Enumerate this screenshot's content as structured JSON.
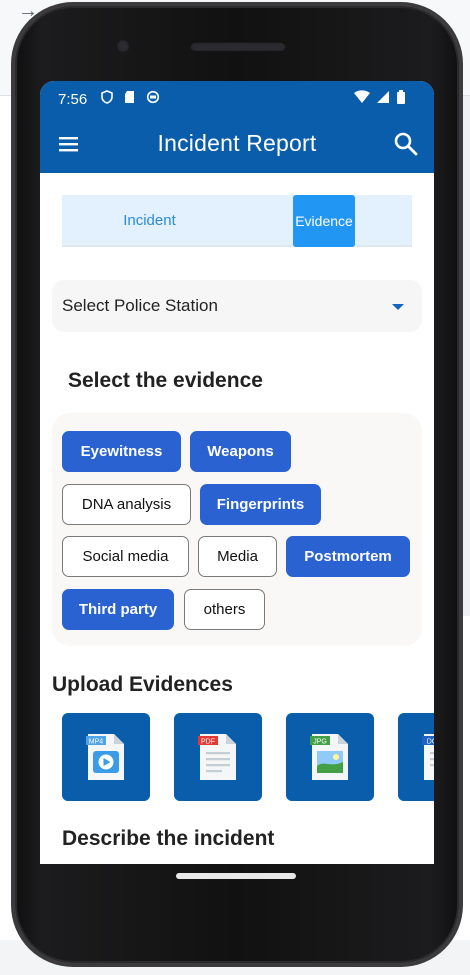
{
  "status_bar": {
    "time": "7:56"
  },
  "app_bar": {
    "title": "Incident Report"
  },
  "tabs": [
    {
      "label": "Incident",
      "selected": false
    },
    {
      "label": "Evidence",
      "selected": true
    }
  ],
  "police_station": {
    "label": "Select Police Station"
  },
  "evidence_section": {
    "title": "Select the evidence",
    "chips": [
      {
        "label": "Eyewitness",
        "selected": true
      },
      {
        "label": "Weapons",
        "selected": true
      },
      {
        "label": "DNA analysis",
        "selected": false
      },
      {
        "label": "Fingerprints",
        "selected": true
      },
      {
        "label": "Social media",
        "selected": false
      },
      {
        "label": "Media",
        "selected": false
      },
      {
        "label": "Postmortem",
        "selected": true
      },
      {
        "label": "Third party",
        "selected": true
      },
      {
        "label": "others",
        "selected": false
      }
    ]
  },
  "upload_section": {
    "title": "Upload Evidences",
    "tiles": [
      {
        "type": "MP4",
        "icon": "mp4-file-icon"
      },
      {
        "type": "PDF",
        "icon": "pdf-file-icon"
      },
      {
        "type": "JPG",
        "icon": "jpg-file-icon"
      },
      {
        "type": "DO",
        "icon": "doc-file-icon"
      }
    ]
  },
  "describe_section": {
    "title": "Describe the incident"
  },
  "colors": {
    "primary": "#0a5dab",
    "chip_selected": "#2b62d1",
    "tab_selected": "#2196f3",
    "tab_bar": "#e3f0fd"
  }
}
